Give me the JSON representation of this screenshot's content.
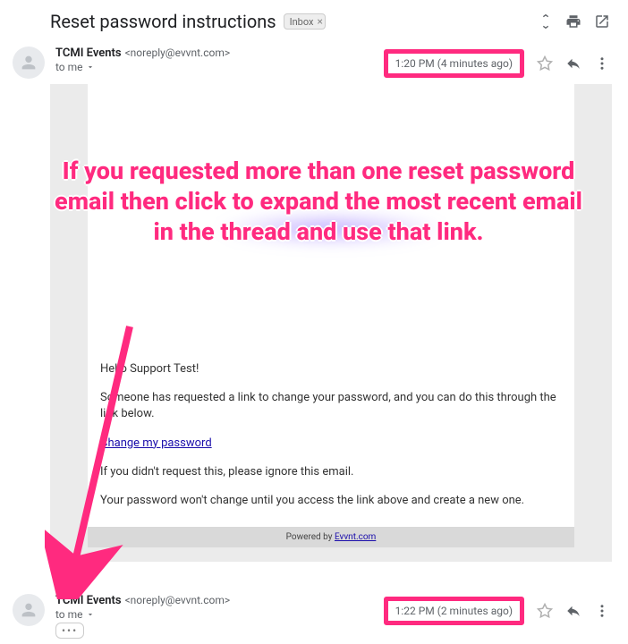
{
  "subject": "Reset password instructions",
  "inbox_label": "Inbox",
  "msg1": {
    "sender_name": "TCMI Events",
    "sender_email": "<noreply@evvnt.com>",
    "to_line": "to me",
    "timestamp": "1:20 PM (4 minutes ago)",
    "body": {
      "greeting": "Hello Support Test!",
      "p1": "Someone has requested a link to change your password, and you can do this through the link below.",
      "link": "Change my password",
      "p2": "If you didn't request this, please ignore this email.",
      "p3": "Your password won't change until you access the link above and create a new one.",
      "powered": "Powered by ",
      "powered_link": "Evvnt.com"
    }
  },
  "msg2": {
    "sender_name": "TCMI Events",
    "sender_email": "<noreply@evvnt.com>",
    "to_line": "to me",
    "timestamp": "1:22 PM (2 minutes ago)"
  },
  "annotation": "If you requested more than one reset password email then click to expand the most recent email in the thread and use that link."
}
